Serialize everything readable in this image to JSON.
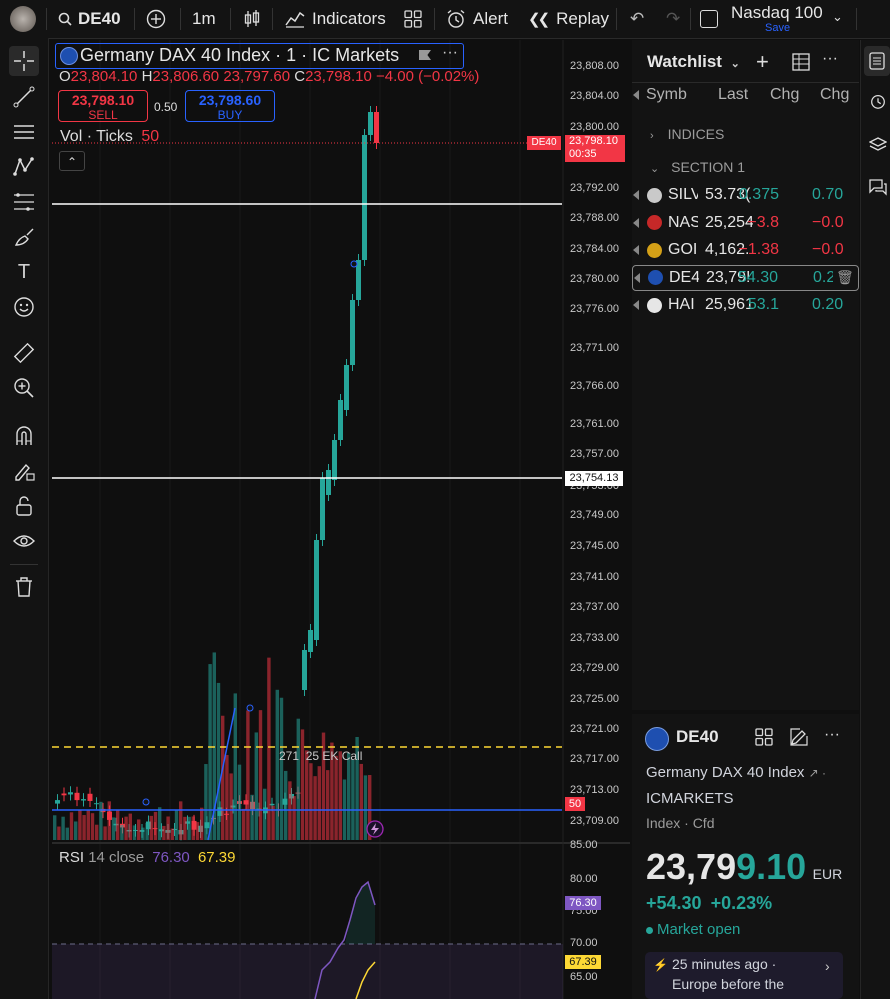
{
  "topbar": {
    "symbol": "DE40",
    "interval": "1m",
    "indicators": "Indicators",
    "alert": "Alert",
    "replay": "Replay",
    "layout_name": "Nasdaq 100",
    "save": "Save"
  },
  "legend": {
    "title": "Germany DAX 40 Index · 1 · IC Markets",
    "o_label": "O",
    "o": "23,804.10",
    "h_label": "H",
    "h": "23,806.60",
    "l": "23,797.60",
    "c_label": "C",
    "c": "23,798.10",
    "change": "−4.00 (−0.02%)",
    "sell_price": "23,798.10",
    "sell_label": "SELL",
    "spread": "0.50",
    "buy_price": "23,798.60",
    "buy_label": "BUY",
    "vol_label": "Vol · Ticks",
    "vol_value": "50"
  },
  "price_axis": {
    "ticks": [
      "23,808.00",
      "23,804.00",
      "23,800.00",
      "23,796.00",
      "23,792.00",
      "23,788.00",
      "23,784.00",
      "23,780.00",
      "23,776.00",
      "23,771.00",
      "23,766.00",
      "23,761.00",
      "23,757.00",
      "23,753.00",
      "23,749.00",
      "23,745.00",
      "23,741.00",
      "23,737.00",
      "23,733.00",
      "23,729.00",
      "23,725.00",
      "23,721.00",
      "23,717.00",
      "23,713.00",
      "23,709.00"
    ],
    "current_tag": "DE40",
    "current_price": "23,798.10",
    "countdown": "00:35",
    "hline_price": "23,754.13",
    "vol_tag": "50"
  },
  "annotation": {
    "text": "271  25 EK Call"
  },
  "rsi": {
    "label": "RSI",
    "params": "14 close",
    "value": "76.30",
    "ma": "67.39",
    "ticks": [
      "85.00",
      "80.00",
      "75.00",
      "70.00",
      "65.00"
    ],
    "tag_rsi": "76.30",
    "tag_ma": "67.39"
  },
  "watchlist": {
    "title": "Watchlist",
    "columns": [
      "Symb",
      "Last",
      "Chg",
      "Chg"
    ],
    "groups": [
      "INDICES",
      "SECTION 1"
    ],
    "rows": [
      {
        "sym": "SILV",
        "last": "53.73(",
        "chg": "0.375",
        "chgp": "0.70",
        "dir": "pos"
      },
      {
        "sym": "NAS",
        "last": "25,254",
        "chg": "−3.8",
        "chgp": "−0.0",
        "dir": "neg"
      },
      {
        "sym": "GOI",
        "last": "4,162.",
        "chg": "−1.38",
        "chgp": "−0.0",
        "dir": "neg"
      },
      {
        "sym": "DE4",
        "last": "23,79!",
        "chg": "54.30",
        "chgp": "0.2",
        "dir": "pos"
      },
      {
        "sym": "HAI",
        "last": "25,961",
        "chg": "53.1",
        "chgp": "0.20",
        "dir": "pos"
      }
    ]
  },
  "detail": {
    "symbol": "DE40",
    "name": "Germany DAX 40 Index",
    "exchange": "ICMARKETS",
    "type": "Index · Cfd",
    "price_main": "23,79",
    "price_tail": "9.10",
    "currency": "EUR",
    "change": "+54.30",
    "change_pct": "+0.23%",
    "status": "Market open",
    "news_time": "25 minutes ago ·",
    "news_text": "Europe before the"
  },
  "colors": {
    "up": "#26a69a",
    "down": "#f23645",
    "accent": "#2962ff",
    "rsi": "#7e57c2",
    "rsi_ma": "#fdd835"
  }
}
